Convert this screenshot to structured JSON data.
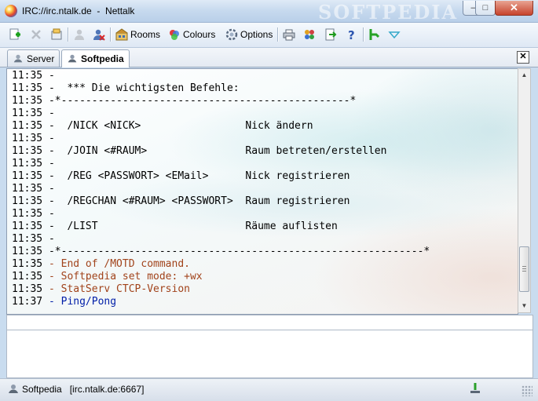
{
  "window": {
    "title": "IRC://irc.ntalk.de  -  Nettalk",
    "watermark": "SOFTPEDIA",
    "controls": {
      "minimize": "–",
      "maximize": "□",
      "close": "✕"
    }
  },
  "toolbar": {
    "rooms_label": "Rooms",
    "colours_label": "Colours",
    "options_label": "Options",
    "icons": [
      "new-connection-icon",
      "disconnect-icon",
      "settings-icon",
      "user-icon",
      "remove-user-icon",
      "rooms-icon",
      "colours-icon",
      "options-icon",
      "print-icon",
      "users-icon",
      "export-icon",
      "help-icon",
      "connect-icon",
      "dropdown-icon"
    ]
  },
  "tabs": [
    {
      "label": "Server",
      "active": false
    },
    {
      "label": "Softpedia",
      "active": true
    }
  ],
  "tab_close": "✕",
  "chat": {
    "lines": [
      {
        "time": "11:35",
        "text": "-",
        "style": "black"
      },
      {
        "time": "11:35",
        "text": "-  *** Die wichtigsten Befehle:",
        "style": "black"
      },
      {
        "time": "11:35",
        "text": "-*-----------------------------------------------*",
        "style": "black"
      },
      {
        "time": "11:35",
        "text": "-",
        "style": "black"
      },
      {
        "time": "11:35",
        "text": "-  /NICK <NICK>                 Nick ändern",
        "style": "black"
      },
      {
        "time": "11:35",
        "text": "-",
        "style": "black"
      },
      {
        "time": "11:35",
        "text": "-  /JOIN <#RAUM>                Raum betreten/erstellen",
        "style": "black"
      },
      {
        "time": "11:35",
        "text": "-",
        "style": "black"
      },
      {
        "time": "11:35",
        "text": "-  /REG <PASSWORT> <EMail>      Nick registrieren",
        "style": "black"
      },
      {
        "time": "11:35",
        "text": "-",
        "style": "black"
      },
      {
        "time": "11:35",
        "text": "-  /REGCHAN <#RAUM> <PASSWORT>  Raum registrieren",
        "style": "black"
      },
      {
        "time": "11:35",
        "text": "-",
        "style": "black"
      },
      {
        "time": "11:35",
        "text": "-  /LIST                        Räume auflisten",
        "style": "black"
      },
      {
        "time": "11:35",
        "text": "-",
        "style": "black"
      },
      {
        "time": "11:35",
        "text": "-*-----------------------------------------------------------*",
        "style": "black"
      },
      {
        "time": "11:35",
        "text": "- End of /MOTD command.",
        "style": "brown"
      },
      {
        "time": "11:35",
        "text": "- Softpedia set mode: +wx",
        "style": "brown"
      },
      {
        "time": "11:35",
        "text": "- StatServ CTCP-Version",
        "style": "brown"
      },
      {
        "time": "11:37",
        "text": "- Ping/Pong",
        "style": "blue"
      }
    ]
  },
  "input": {
    "value": "",
    "placeholder": ""
  },
  "status": {
    "text": "Softpedia   [irc.ntalk.de:6667]"
  },
  "colors": {
    "brown": "#a1431b",
    "blue": "#001ea8",
    "titlebar": "#c6d9ee"
  }
}
